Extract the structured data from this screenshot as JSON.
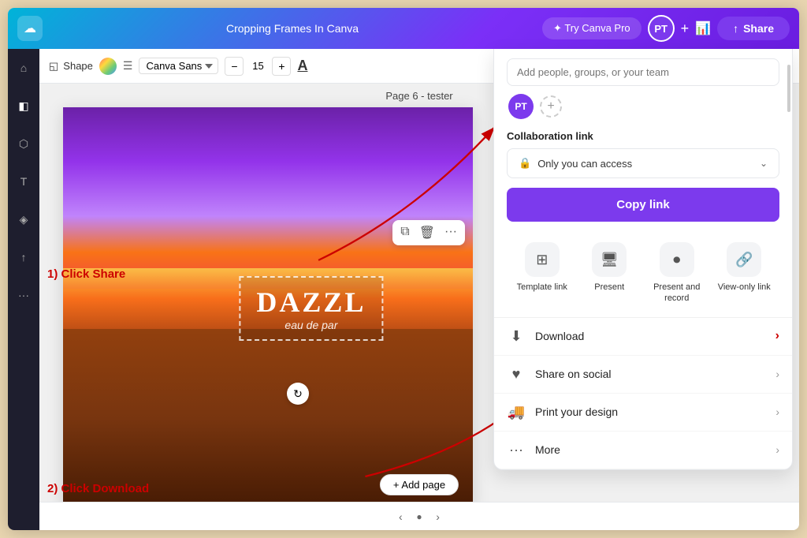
{
  "topbar": {
    "logo_symbol": "☁",
    "title": "Cropping Frames In Canva",
    "try_pro_label": "✦ Try Canva Pro",
    "avatar_initials": "PT",
    "share_label": "Share",
    "share_icon": "↑"
  },
  "toolbar": {
    "shape_label": "Shape",
    "font_name": "Canva Sans",
    "font_size": "15",
    "minus_label": "−",
    "plus_label": "+",
    "text_style_label": "A"
  },
  "canvas": {
    "page_label": "Page 6 - tester",
    "text_main": "DAZZL",
    "text_sub": "eau de par",
    "add_page_label": "+ Add page"
  },
  "annotations": {
    "label_1": "1) Click Share",
    "label_2": "2) Click Download"
  },
  "share_panel": {
    "add_people_placeholder": "Add people, groups, or your team",
    "avatar_initials": "PT",
    "collab_label": "Collaboration link",
    "collab_access": "Only you can access",
    "copy_link_label": "Copy link",
    "action_links": [
      {
        "icon": "⊞",
        "label": "Template link"
      },
      {
        "icon": "🖥",
        "label": "Present"
      },
      {
        "icon": "⏺",
        "label": "Present and record"
      },
      {
        "icon": "🔗",
        "label": "View-only link"
      }
    ],
    "menu_items": [
      {
        "icon": "⬇",
        "label": "Download",
        "chevron": "›"
      },
      {
        "icon": "♥",
        "label": "Share on social",
        "chevron": "›"
      },
      {
        "icon": "🚚",
        "label": "Print your design",
        "chevron": "›"
      },
      {
        "icon": "•••",
        "label": "More",
        "chevron": "›"
      }
    ]
  },
  "colors": {
    "brand_purple": "#7c3aed",
    "brand_gradient_start": "#00b4d8",
    "topbar_bg": "#7b2ff7",
    "annotation_red": "#cc0000"
  }
}
